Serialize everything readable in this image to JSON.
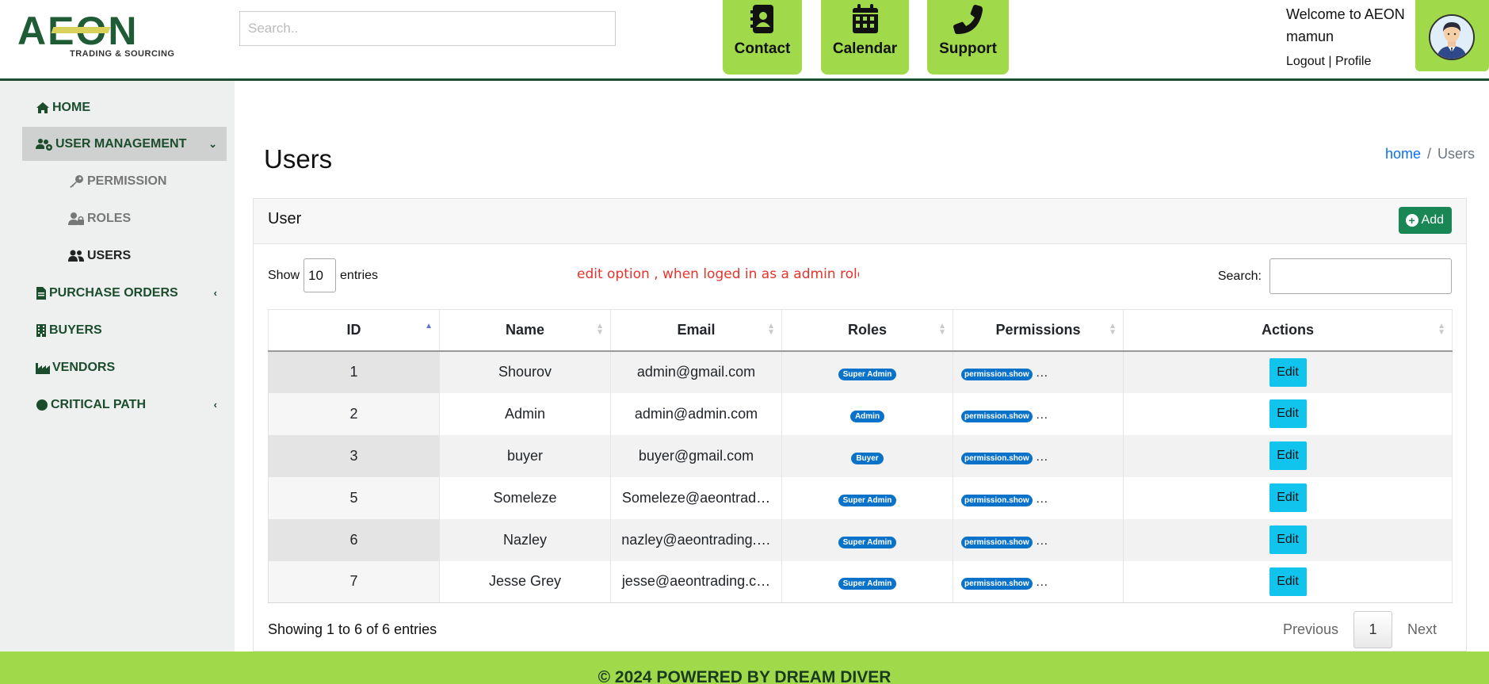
{
  "header": {
    "logo_text": "AEON",
    "logo_sub": "TRADING & SOURCING",
    "search_placeholder": "Search..",
    "quick_buttons": [
      {
        "label": "Contact",
        "icon": "contact-book-icon"
      },
      {
        "label": "Calendar",
        "icon": "calendar-icon"
      },
      {
        "label": "Support",
        "icon": "phone-icon"
      }
    ],
    "welcome_line1": "Welcome to AEON",
    "welcome_line2": "mamun",
    "logout": "Logout",
    "separator": "|",
    "profile": "Profile"
  },
  "sidebar": {
    "items": [
      {
        "label": "HOME",
        "icon": "home-icon"
      },
      {
        "label": "USER MANAGEMENT",
        "icon": "users-cog-icon",
        "arrow": "⌄"
      },
      {
        "label": "PERMISSION",
        "icon": "key-icon"
      },
      {
        "label": "ROLES",
        "icon": "user-lock-icon"
      },
      {
        "label": "USERS",
        "icon": "users-icon"
      },
      {
        "label": "PURCHASE ORDERS",
        "icon": "file-icon",
        "arrow": "‹"
      },
      {
        "label": "BUYERS",
        "icon": "building-icon"
      },
      {
        "label": "VENDORS",
        "icon": "industry-icon"
      },
      {
        "label": "CRITICAL PATH",
        "icon": "circle-icon",
        "arrow": "‹"
      }
    ]
  },
  "main": {
    "title": "Users",
    "breadcrumb": {
      "home": "home",
      "sep": "/",
      "current": "Users"
    },
    "card_title": "User",
    "add_label": "Add",
    "show_label": "Show",
    "show_value": "10",
    "entries_label": "entries",
    "note": "edit option , when loged in as a admin role",
    "search_label": "Search:",
    "columns": [
      "ID",
      "Name",
      "Email",
      "Roles",
      "Permissions",
      "Actions"
    ],
    "rows": [
      {
        "id": "1",
        "name": "Shourov",
        "email": "admin@gmail.com",
        "role": "Super Admin",
        "permission": "permission.show",
        "more": "…",
        "action": "Edit"
      },
      {
        "id": "2",
        "name": "Admin",
        "email": "admin@admin.com",
        "role": "Admin",
        "permission": "permission.show",
        "more": "…",
        "action": "Edit"
      },
      {
        "id": "3",
        "name": "buyer",
        "email": "buyer@gmail.com",
        "role": "Buyer",
        "permission": "permission.show",
        "more": "…",
        "action": "Edit"
      },
      {
        "id": "5",
        "name": "Someleze",
        "email": "Someleze@aeontrad…",
        "role": "Super Admin",
        "permission": "permission.show",
        "more": "…",
        "action": "Edit"
      },
      {
        "id": "6",
        "name": "Nazley",
        "email": "nazley@aeontrading.…",
        "role": "Super Admin",
        "permission": "permission.show",
        "more": "…",
        "action": "Edit"
      },
      {
        "id": "7",
        "name": "Jesse Grey",
        "email": "jesse@aeontrading.c…",
        "role": "Super Admin",
        "permission": "permission.show",
        "more": "…",
        "action": "Edit"
      }
    ],
    "info": "Showing 1 to 6 of 6 entries",
    "pager": {
      "previous": "Previous",
      "current": "1",
      "next": "Next"
    }
  },
  "footer": {
    "text": "© 2024 POWERED BY DREAM DIVER"
  },
  "colors": {
    "accent": "#a0d94a",
    "brand": "#1f5c36",
    "badge": "#0a73c9",
    "edit": "#10c4ee",
    "add": "#198754"
  }
}
